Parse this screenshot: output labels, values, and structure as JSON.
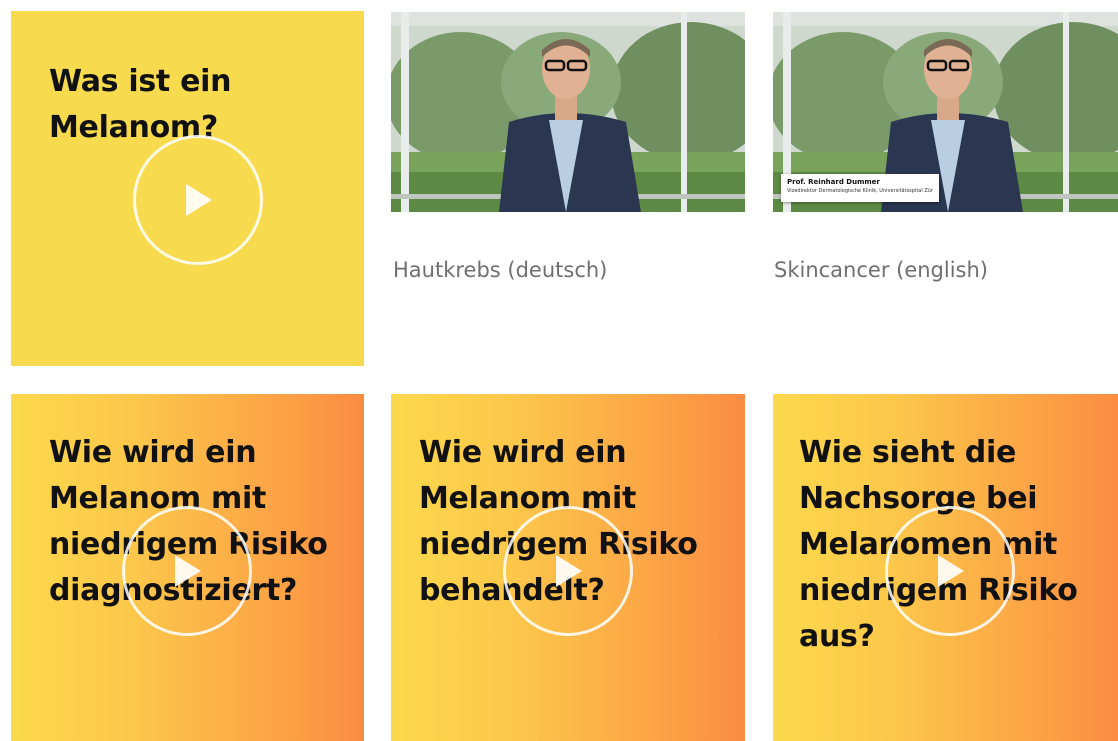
{
  "tiles": [
    {
      "title": "Was ist ein Melanom?",
      "action": "play-video"
    },
    {
      "title": "Wie wird ein Melanom mit niedrigem Risiko diagnostiziert?",
      "action": "play-video"
    },
    {
      "title": "Wie wird ein Melanom mit niedrigem Risiko behandelt?",
      "action": "play-video"
    },
    {
      "title": "Wie sieht die Nachsorge bei Melanomen mit niedrigem Risiko aus?",
      "action": "play-video"
    }
  ],
  "videos": [
    {
      "caption": "Hautkrebs (deutsch)"
    },
    {
      "caption": "Skincancer (english)",
      "lower_third_name": "Prof. Reinhard Dummer",
      "lower_third_subtitle": "Vizedirektor Dermatologische Klinik, Universitätsspital Zürich"
    }
  ],
  "colors": {
    "yellow_tile": "#f8da4e",
    "gradient_start": "#fcd94c",
    "gradient_end": "#fb8c42",
    "caption_text": "#6f6f6f",
    "title_text": "#111111"
  },
  "icons": [
    "play-icon"
  ]
}
